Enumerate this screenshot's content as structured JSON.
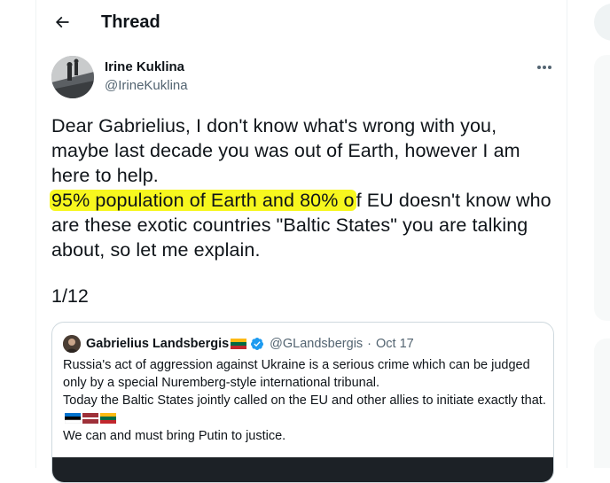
{
  "header": {
    "title": "Thread",
    "back_icon": "arrow-left-icon"
  },
  "tweet": {
    "author_name": "Irine Kuklina",
    "author_handle": "@IrineKuklina",
    "more_icon": "more-horizontal-icon",
    "text_line1": "Dear Gabrielius, I don't know what's wrong with you, maybe last decade you was out of Earth, however I am here to help.",
    "text_highlight": "95% population of Earth and 80% o",
    "text_line2_rest": "f EU doesn't know who are these exotic countries \"Baltic States\" you are talking about, so let me explain.",
    "highlight_color": "#f7f71e",
    "counter": "1/12"
  },
  "quoted_tweet": {
    "author_name": "Gabrielius Landsbergis",
    "author_flag": "lithuania-flag-icon",
    "verified_icon": "verified-badge-icon",
    "verified_color": "#1d9bf0",
    "handle": "@GLandsbergis",
    "separator": "·",
    "date": "Oct 17",
    "para1": "Russia's act of aggression against Ukraine is a serious crime which can be judged only by a special Nuremberg-style international tribunal.",
    "para2": "Today the Baltic States jointly called on the EU and other allies to initiate exactly that.",
    "para2_flags": [
      "estonia-flag-icon",
      "latvia-flag-icon",
      "lithuania-flag-icon"
    ],
    "para3": "We can and must bring Putin to justice."
  },
  "colors": {
    "text": "#0f1419",
    "secondary": "#536471",
    "border": "#eff3f4",
    "quote_border": "#cfd9de"
  }
}
